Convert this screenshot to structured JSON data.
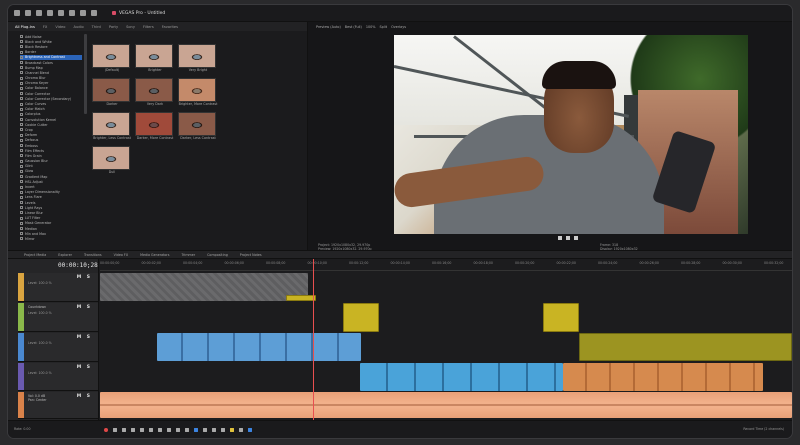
{
  "app": {
    "project_title": "VEGAS Pro - Untitled"
  },
  "fx_panel": {
    "tabs": [
      "All Plug-Ins",
      "FX",
      "Video",
      "Audio",
      "Third",
      "Party",
      "Sony",
      "Filters",
      "Favorites"
    ],
    "items": [
      "Add Noise",
      "Black and White",
      "Black Restore",
      "Border",
      "Brightness and Contrast",
      "Broadcast Colors",
      "Bump Map",
      "Channel Blend",
      "Chroma Blur",
      "Chroma Keyer",
      "Color Balance",
      "Color Corrector",
      "Color Corrector (Secondary)",
      "Color Curves",
      "Color Match",
      "Colorplus",
      "Convolution Kernel",
      "Cookie Cutter",
      "Crop",
      "Deform",
      "Defocus",
      "Emboss",
      "Film Effects",
      "Film Grain",
      "Gaussian Blur",
      "Glint",
      "Glow",
      "Gradient Map",
      "HSL Adjust",
      "Invert",
      "Layer Dimensionality",
      "Lens Flare",
      "Levels",
      "Light Rays",
      "Linear Blur",
      "LUT Filter",
      "Mask Generator",
      "Median",
      "Min and Max",
      "Mirror"
    ],
    "selected_index": 4,
    "presets": [
      "(Default)",
      "Brighter",
      "Very Bright",
      "Darker",
      "Very Dark",
      "Brighter, More Contrast",
      "Brighter, Less Contrast",
      "Darker, More Contrast",
      "Darker, Less Contrast",
      "Dull"
    ]
  },
  "viewer": {
    "tools": [
      "Preview (Auto)",
      "Best (Full)",
      "100%",
      "Split",
      "Overlays"
    ],
    "info_left": "Project: 1920x1080x32, 29.970p\nPreview: 1920x1080x32, 29.970p\nVideo Preview",
    "info_right": "Frame: 318\nDisplay: 1920x1080x32"
  },
  "lower_tabs": [
    "Project Media",
    "Explorer",
    "Transitions",
    "Video FX",
    "Media Generators",
    "Trimmer",
    "Compositing",
    "Project Notes"
  ],
  "timeline": {
    "timecode": "00:00:10;28",
    "ruler_ticks": [
      "00:00:00;00",
      "00:00:02;00",
      "00:00:04;00",
      "00:00:06;00",
      "00:00:08;00",
      "00:00:10;00",
      "00:00:12;00",
      "00:00:14;00",
      "00:00:16;00",
      "00:00:18;00",
      "00:00:20;00",
      "00:00:22;00",
      "00:00:24;00",
      "00:00:26;00",
      "00:00:28;00",
      "00:00:30;00",
      "00:00:32;00"
    ],
    "tracks": [
      {
        "name": "",
        "level": "Level: 100.0 %",
        "color": "#d9a440"
      },
      {
        "name": "Countdown",
        "level": "Level: 100.0 %",
        "color": "#8ab84a"
      },
      {
        "name": "",
        "level": "Level: 100.0 %",
        "color": "#4a88d0"
      },
      {
        "name": "",
        "level": "Level: 100.0 %",
        "color": "#6a5ab0"
      },
      {
        "name": "Vol: 0.0 dB\nPan: Center",
        "level": "",
        "color": "#d9824a"
      }
    ],
    "audio_label": "Vol: 0.0 dB"
  },
  "bottombar": {
    "left": "Rate: 0.00",
    "right": "Record Time (2 channels)"
  }
}
